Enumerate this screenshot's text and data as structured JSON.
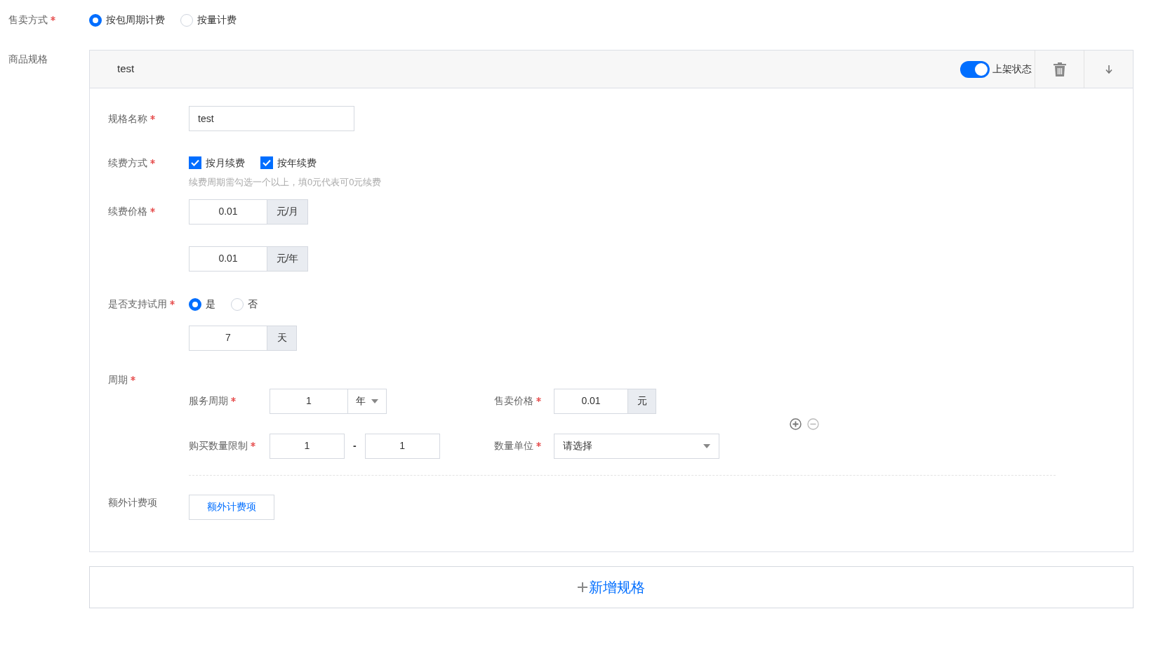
{
  "sale_mode": {
    "label": "售卖方式",
    "required": true,
    "options": [
      {
        "label": "按包周期计费",
        "selected": true
      },
      {
        "label": "按量计费",
        "selected": false
      }
    ]
  },
  "specs_label": "商品规格",
  "spec": {
    "title": "test",
    "listed": {
      "label": "上架状态",
      "on": true
    },
    "name": {
      "label": "规格名称",
      "required": true,
      "value": "test"
    },
    "renewal": {
      "label": "续费方式",
      "required": true,
      "options": [
        {
          "label": "按月续费",
          "checked": true
        },
        {
          "label": "按年续费",
          "checked": true
        }
      ],
      "hint": "续费周期需勾选一个以上，填0元代表可0元续费"
    },
    "renewal_price": {
      "label": "续费价格",
      "required": true,
      "rows": [
        {
          "value": "0.01",
          "unit": "元/月"
        },
        {
          "value": "0.01",
          "unit": "元/年"
        }
      ]
    },
    "trial": {
      "label": "是否支持试用",
      "required": true,
      "options": [
        {
          "label": "是",
          "selected": true
        },
        {
          "label": "否",
          "selected": false
        }
      ],
      "days": {
        "value": "7",
        "unit": "天"
      }
    },
    "period": {
      "label": "周期",
      "required": true,
      "service_period": {
        "label": "服务周期",
        "required": true,
        "value": "1",
        "unit": "年"
      },
      "sale_price": {
        "label": "售卖价格",
        "required": true,
        "value": "0.01",
        "unit": "元"
      },
      "quantity_limit": {
        "label": "购买数量限制",
        "required": true,
        "min": "1",
        "separator": "-",
        "max": "1"
      },
      "quantity_unit": {
        "label": "数量单位",
        "required": true,
        "placeholder": "请选择"
      }
    },
    "extra": {
      "label": "额外计费项",
      "button": "额外计费项"
    }
  },
  "add_spec_button": "新增规格"
}
